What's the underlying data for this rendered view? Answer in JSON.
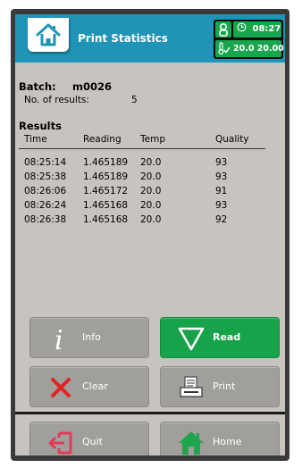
{
  "header": {
    "title": "Print Statistics",
    "time": "08:27",
    "temperature": "20.0 20.00"
  },
  "batch": {
    "label": "Batch:",
    "value": "m0026",
    "results_label": "No. of results:",
    "results_count": "5"
  },
  "results": {
    "title": "Results",
    "columns": [
      "Time",
      "Reading",
      "Temp",
      "Quality"
    ],
    "rows": [
      [
        "08:25:14",
        "1.465189",
        "20.0",
        "93"
      ],
      [
        "08:25:38",
        "1.465189",
        "20.0",
        "93"
      ],
      [
        "08:26:06",
        "1.465172",
        "20.0",
        "91"
      ],
      [
        "08:26:24",
        "1.465168",
        "20.0",
        "93"
      ],
      [
        "08:26:38",
        "1.465168",
        "20.0",
        "92"
      ]
    ]
  },
  "buttons": {
    "info": "Info",
    "read": "Read",
    "clear": "Clear",
    "print": "Print",
    "quit": "Quit",
    "home": "Home"
  },
  "colors": {
    "header": "#1f94b6",
    "status_green": "#17a64c",
    "read_green": "#16a34a",
    "button_gray": "#a19f9c",
    "screen_bg": "#c7c4bf",
    "quit_red": "#e23a5a",
    "home_green": "#1fa64c"
  }
}
